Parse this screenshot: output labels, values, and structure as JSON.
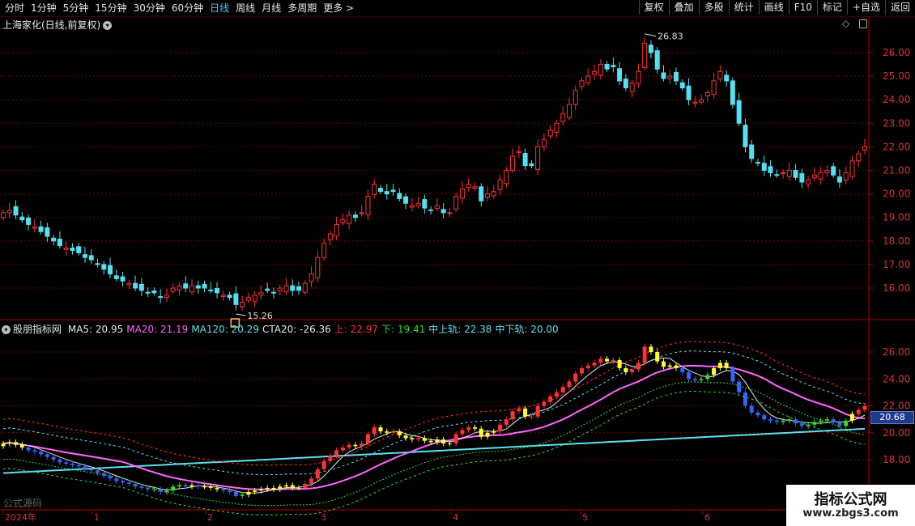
{
  "toolbar": {
    "periods": [
      "分时",
      "1分钟",
      "5分钟",
      "15分钟",
      "30分钟",
      "60分钟",
      "日线",
      "周线",
      "月线",
      "多周期",
      "更多 >"
    ],
    "active_period": "日线",
    "right_buttons": [
      "复权",
      "叠加",
      "多股",
      "统计",
      "画线",
      "F10",
      "标记",
      "+自选",
      "返回"
    ]
  },
  "main_panel": {
    "title": "上海家化(日线,前复权)",
    "high_label": "26.83",
    "low_label": "15.26",
    "y_ticks": [
      "26.00",
      "25.00",
      "24.00",
      "23.00",
      "22.00",
      "21.00",
      "20.00",
      "19.00",
      "18.00",
      "17.00",
      "16.00"
    ]
  },
  "indicator_panel": {
    "name": "股朋指标网",
    "items": [
      {
        "label": "MA5: 20.95",
        "color": "#e8e8e8"
      },
      {
        "label": "MA20: 21.19",
        "color": "#ff66ff"
      },
      {
        "label": "MA120: 20.29",
        "color": "#5ee0f0"
      },
      {
        "label": "CTA20: -26.36",
        "color": "#e8e8e8"
      },
      {
        "label": "上: 22.97",
        "color": "#ff3333"
      },
      {
        "label": "下: 19.41",
        "color": "#33dd33"
      },
      {
        "label": "中上轨: 22.38",
        "color": "#5ee0f0"
      },
      {
        "label": "中下轨: 20.00",
        "color": "#5ee0f0"
      }
    ],
    "y_ticks": [
      "26.00",
      "24.00",
      "22.00",
      "20.00",
      "18.00"
    ],
    "current_price": "20.68"
  },
  "x_axis": {
    "labels": [
      "2024年",
      "1",
      "2",
      "3",
      "4",
      "5",
      "6"
    ]
  },
  "watermark": {
    "title": "指标公式网",
    "url": "www.zbgs3.com",
    "faint": "公式源码"
  },
  "colors": {
    "up": "#ff3333",
    "down": "#54e0f0",
    "grid": "#7a0000",
    "ma5": "#e8e8e8",
    "ma20": "#ff66ff",
    "ma120": "#5ee0f0"
  },
  "chart_data": {
    "type": "candlestick",
    "title": "上海家化(日线,前复权)",
    "ylim": [
      15.0,
      27.0
    ],
    "closes": [
      19.2,
      19.3,
      19.1,
      18.9,
      18.7,
      18.6,
      18.4,
      18.2,
      18.0,
      17.8,
      17.7,
      17.6,
      17.5,
      17.3,
      17.2,
      17.0,
      16.8,
      16.6,
      16.4,
      16.3,
      16.2,
      16.0,
      15.9,
      15.8,
      15.8,
      15.6,
      15.7,
      16.0,
      16.1,
      16.0,
      16.1,
      16.0,
      16.0,
      15.9,
      15.8,
      15.7,
      15.6,
      15.3,
      15.4,
      15.6,
      15.7,
      15.8,
      15.9,
      15.8,
      16.0,
      16.1,
      15.9,
      15.9,
      16.2,
      16.6,
      17.3,
      17.9,
      18.3,
      18.7,
      18.9,
      19.1,
      19.0,
      19.2,
      19.9,
      20.4,
      20.1,
      20.0,
      20.1,
      19.8,
      19.6,
      19.5,
      19.6,
      19.4,
      19.3,
      19.5,
      19.2,
      19.2,
      19.9,
      20.2,
      20.4,
      20.3,
      19.7,
      20.0,
      20.1,
      20.6,
      21.0,
      21.6,
      21.8,
      21.2,
      21.2,
      22.0,
      22.3,
      22.7,
      23.0,
      23.4,
      23.8,
      24.4,
      24.8,
      25.0,
      25.2,
      25.5,
      25.3,
      25.4,
      24.8,
      24.5,
      24.7,
      25.2,
      26.4,
      26.0,
      25.3,
      24.9,
      25.0,
      24.8,
      24.5,
      24.0,
      23.9,
      24.0,
      24.3,
      24.8,
      25.2,
      24.8,
      23.8,
      23.0,
      22.0,
      21.5,
      21.3,
      21.0,
      20.9,
      20.8,
      20.9,
      21.0,
      20.7,
      20.5,
      20.6,
      20.8,
      20.9,
      21.0,
      20.8,
      20.5,
      20.9,
      21.4,
      21.7,
      22.0
    ]
  }
}
